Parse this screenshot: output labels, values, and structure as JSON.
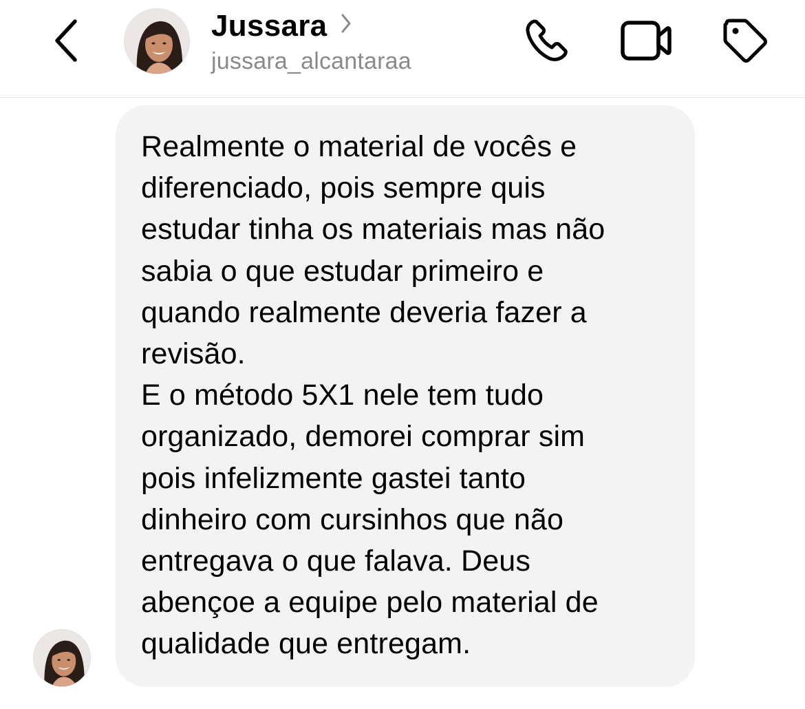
{
  "header": {
    "back_icon": "chevron-left-icon",
    "avatar_icon": "profile-photo",
    "name": "Jussara",
    "name_chevron_icon": "chevron-right-icon",
    "username": "jussara_alcantaraa",
    "actions": {
      "call_icon": "phone-icon",
      "video_icon": "video-camera-icon",
      "tag_icon": "tag-icon"
    }
  },
  "thread": {
    "message": {
      "lines": [
        "Realmente o material de vocês e",
        "diferenciado, pois sempre quis",
        "estudar tinha os materiais mas não",
        "sabia o que estudar primeiro e",
        "quando realmente deveria fazer a",
        "revisão.",
        "E o método 5X1 nele tem tudo",
        "organizado, demorei comprar sim",
        "pois infelizmente gastei tanto",
        "dinheiro com cursinhos que não",
        "entregava o que falava. Deus",
        "abençoe a equipe pelo material de",
        "qualidade que entregam."
      ],
      "bubble_color": "#f2f3f5"
    },
    "sender_avatar_icon": "profile-photo"
  },
  "colors": {
    "background": "#ffffff",
    "secondary_text": "#8a8a8e",
    "divider": "#e6e6e8"
  }
}
